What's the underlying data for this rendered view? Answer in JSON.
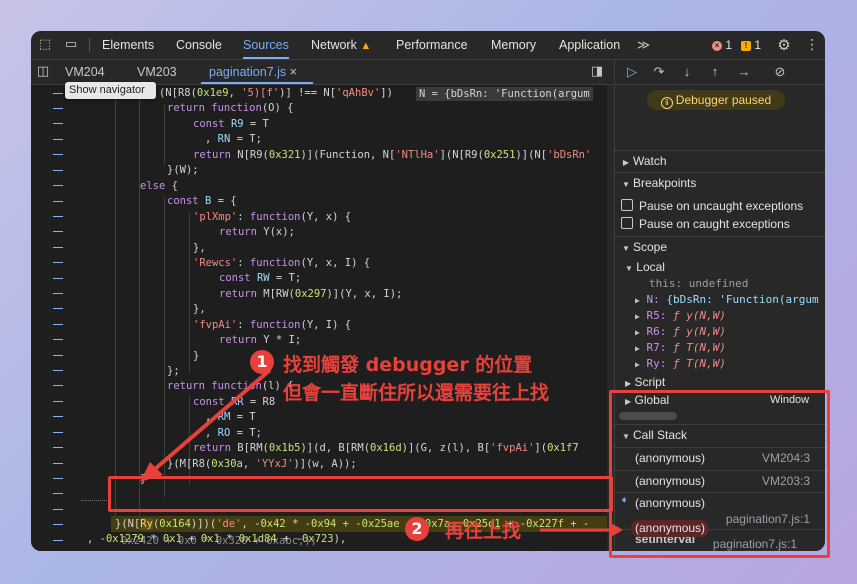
{
  "top_tabs": [
    "Elements",
    "Console",
    "Sources",
    "Network",
    "Performance",
    "Memory",
    "Application"
  ],
  "active_top_tab": "Sources",
  "error_count": "1",
  "warning_count": "1",
  "more_tabs_glyph": "≫",
  "tooltip": "Show navigator",
  "file_tabs": [
    "VM204",
    "VM203",
    "pagination7.js"
  ],
  "active_file": "pagination7.js",
  "code": {
    "inline_eval": "N = {bDsRn: 'Function(argum"
  },
  "debugger": {
    "paused_label": "Debugger paused",
    "sections": {
      "watch": "Watch",
      "breakpoints": "Breakpoints",
      "scope": "Scope",
      "call_stack": "Call Stack"
    },
    "breakpoint_options": [
      "Pause on uncaught exceptions",
      "Pause on caught exceptions"
    ],
    "scope": {
      "local_label": "Local",
      "this_key": "this:",
      "this_value": "undefined",
      "entries": [
        {
          "key": "N:",
          "value": "{bDsRn: 'Function(argum"
        },
        {
          "key": "R5:",
          "value": "ƒ y(N,W)"
        },
        {
          "key": "R6:",
          "value": "ƒ y(N,W)"
        },
        {
          "key": "R7:",
          "value": "ƒ T(N,W)"
        },
        {
          "key": "Ry:",
          "value": "ƒ T(N,W)"
        }
      ],
      "script_label": "Script",
      "global_label": "Global",
      "global_value": "Window"
    },
    "call_stack": [
      {
        "name": "(anonymous)",
        "location": "VM204:3"
      },
      {
        "name": "(anonymous)",
        "location": "VM203:3"
      },
      {
        "name": "(anonymous)",
        "location": "pagination7.js:1",
        "current": true
      }
    ],
    "async_label": "setInterval",
    "async_frame": {
      "name": "(anonymous)",
      "location": "pagination7.js:1"
    }
  },
  "annotations": {
    "step1_number": "1",
    "step1_line1": "找到觸發 debugger 的位置",
    "step1_line2": "但會一直斷住所以還需要往上找",
    "step2_number": "2",
    "step2_text": "再往上找"
  },
  "colors": {
    "accent": "#7cacf8",
    "annotation_red": "#e8403a",
    "paused_yellow": "#fdd663"
  }
}
